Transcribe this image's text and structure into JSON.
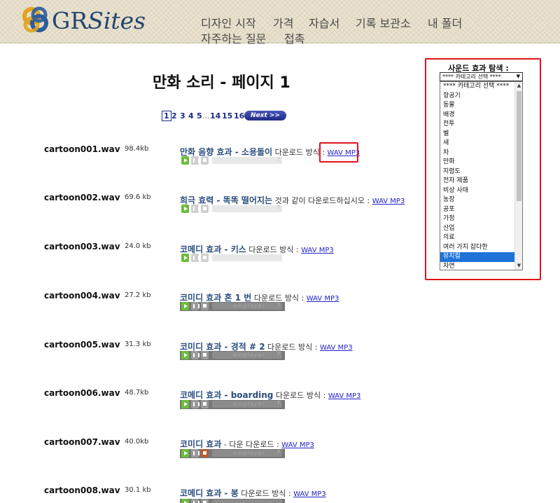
{
  "header": {
    "logo_gr": "GR",
    "logo_sites": "Sites",
    "nav": [
      "디자인 시작",
      "가격",
      "자습서",
      "기록 보관소",
      "내 폴더",
      "자주하는 질문",
      "접촉"
    ]
  },
  "main": {
    "title": "만화 소리 - 페이지 1",
    "pagination": {
      "current": "1",
      "pages": [
        "2",
        "3",
        "4",
        "5"
      ],
      "dots": "...",
      "late_pages": [
        "14",
        "15",
        "16"
      ],
      "next_label": "Next >>"
    },
    "rows": [
      {
        "file": "cartoon001.wav",
        "size": "98.4kb",
        "title": "만화 음향 효과 - 소용돌이",
        "suffix": " 다운로드 방식 : ",
        "link": "WAV MP3",
        "player": "light"
      },
      {
        "file": "cartoon002.wav",
        "size": "69.6 kb",
        "title": "희극 효력 - 똑똑 떨어지는",
        "suffix": " 것과 같이 다운로드하십시오 : ",
        "link": "WAV MP3",
        "player": "light"
      },
      {
        "file": "cartoon003.wav",
        "size": "24.0 kb",
        "title": "코메디 효과 - 키스",
        "suffix": " 다운로드 방식 : ",
        "link": "WAV MP3",
        "player": "light"
      },
      {
        "file": "cartoon004.wav",
        "size": "27.2 kb",
        "title": "코미디 효과 혼 1 번",
        "suffix": " 다운로드 방식 : ",
        "link": "WAV MP3",
        "player": "dark"
      },
      {
        "file": "cartoon005.wav",
        "size": "31.3 kb",
        "title": "코미디 효과 - 경적 # 2",
        "suffix": " 다운로드 방식 : ",
        "link": "WAV MP3",
        "player": "dark"
      },
      {
        "file": "cartoon006.wav",
        "size": "48.7kb",
        "title": "코메디 효과 - boarding",
        "suffix": " 다운로드 방식 : ",
        "link": "WAV MP3",
        "player": "dark"
      },
      {
        "file": "cartoon007.wav",
        "size": "40.0kb",
        "title": "코미디 효과",
        "suffix": " - 다운 다운로드 : ",
        "link": "WAV MP3",
        "player": "dark"
      },
      {
        "file": "cartoon008.wav",
        "size": "30.1 kb",
        "title": "코메디 효과 - 봉",
        "suffix": " 다운로드 방식 : ",
        "link": "WAV MP3",
        "player": "dark"
      }
    ],
    "player_watermark": "emplayer",
    "player_help": "?"
  },
  "sidebar": {
    "title": "사운드 효과 탐색 :",
    "select_value": "**** 카테고리 선택 ****",
    "options": [
      "**** 카테고리 선택 ****",
      "항공기",
      "동물",
      "배경",
      "전투",
      "벨",
      "새",
      "차",
      "만화",
      "지령도",
      "전자 제품",
      "비상 사태",
      "농장",
      "공포",
      "가정",
      "산업",
      "의료",
      "여러 가지 잡다한",
      "뮤지컬",
      "자연"
    ],
    "selected_index": 18
  },
  "colors": {
    "accent_red": "#e0151b",
    "link_blue": "#2b4e7e",
    "selected_blue": "#1e73d8",
    "play_green": "#6cbd3b"
  }
}
